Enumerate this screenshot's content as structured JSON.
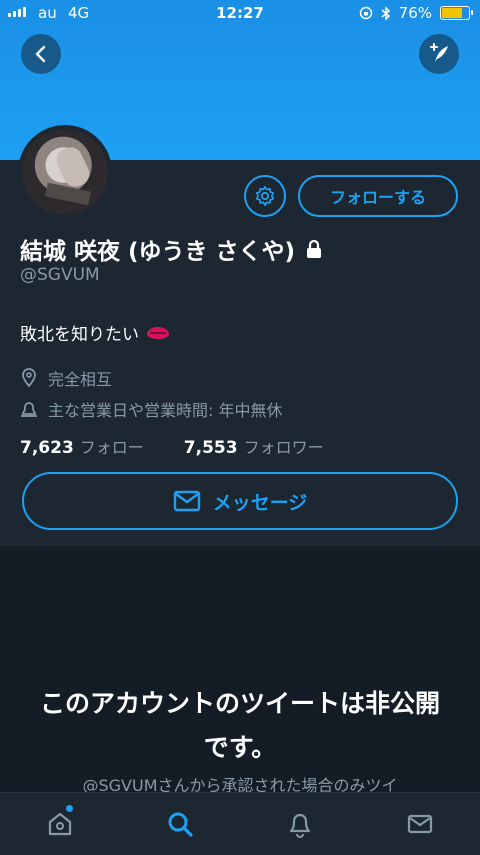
{
  "status_bar": {
    "carrier": "au",
    "network": "4G",
    "time": "12:27",
    "battery": "76%",
    "battery_level": 0.76
  },
  "header": {
    "back_icon": "chevron-left-icon",
    "compose_icon": "compose-tweet-icon"
  },
  "profile": {
    "name": "結城 咲夜 (ゆうき さくや)",
    "handle": "@SGVUM",
    "bio": "敗北を知りたい",
    "location": "完全相互",
    "business_hours": "主な営業日や営業時間: 年中無休",
    "following_count": "7,623",
    "following_label": "フォロー",
    "followers_count": "7,553",
    "followers_label": "フォロワー",
    "follow_button": "フォローする",
    "message_button": "メッセージ"
  },
  "private_notice": {
    "title": "このアカウントのツイートは非公開です。",
    "subtitle": "@SGVUMさんから承認された場合のみツイ"
  },
  "tabbar": {
    "tabs": [
      "home-icon",
      "search-icon",
      "notifications-icon",
      "messages-icon"
    ],
    "active": "search-icon"
  },
  "colors": {
    "accent": "#1da1f2",
    "background": "#141d26",
    "panel": "#1c2732",
    "secondary_text": "#8899a6"
  }
}
